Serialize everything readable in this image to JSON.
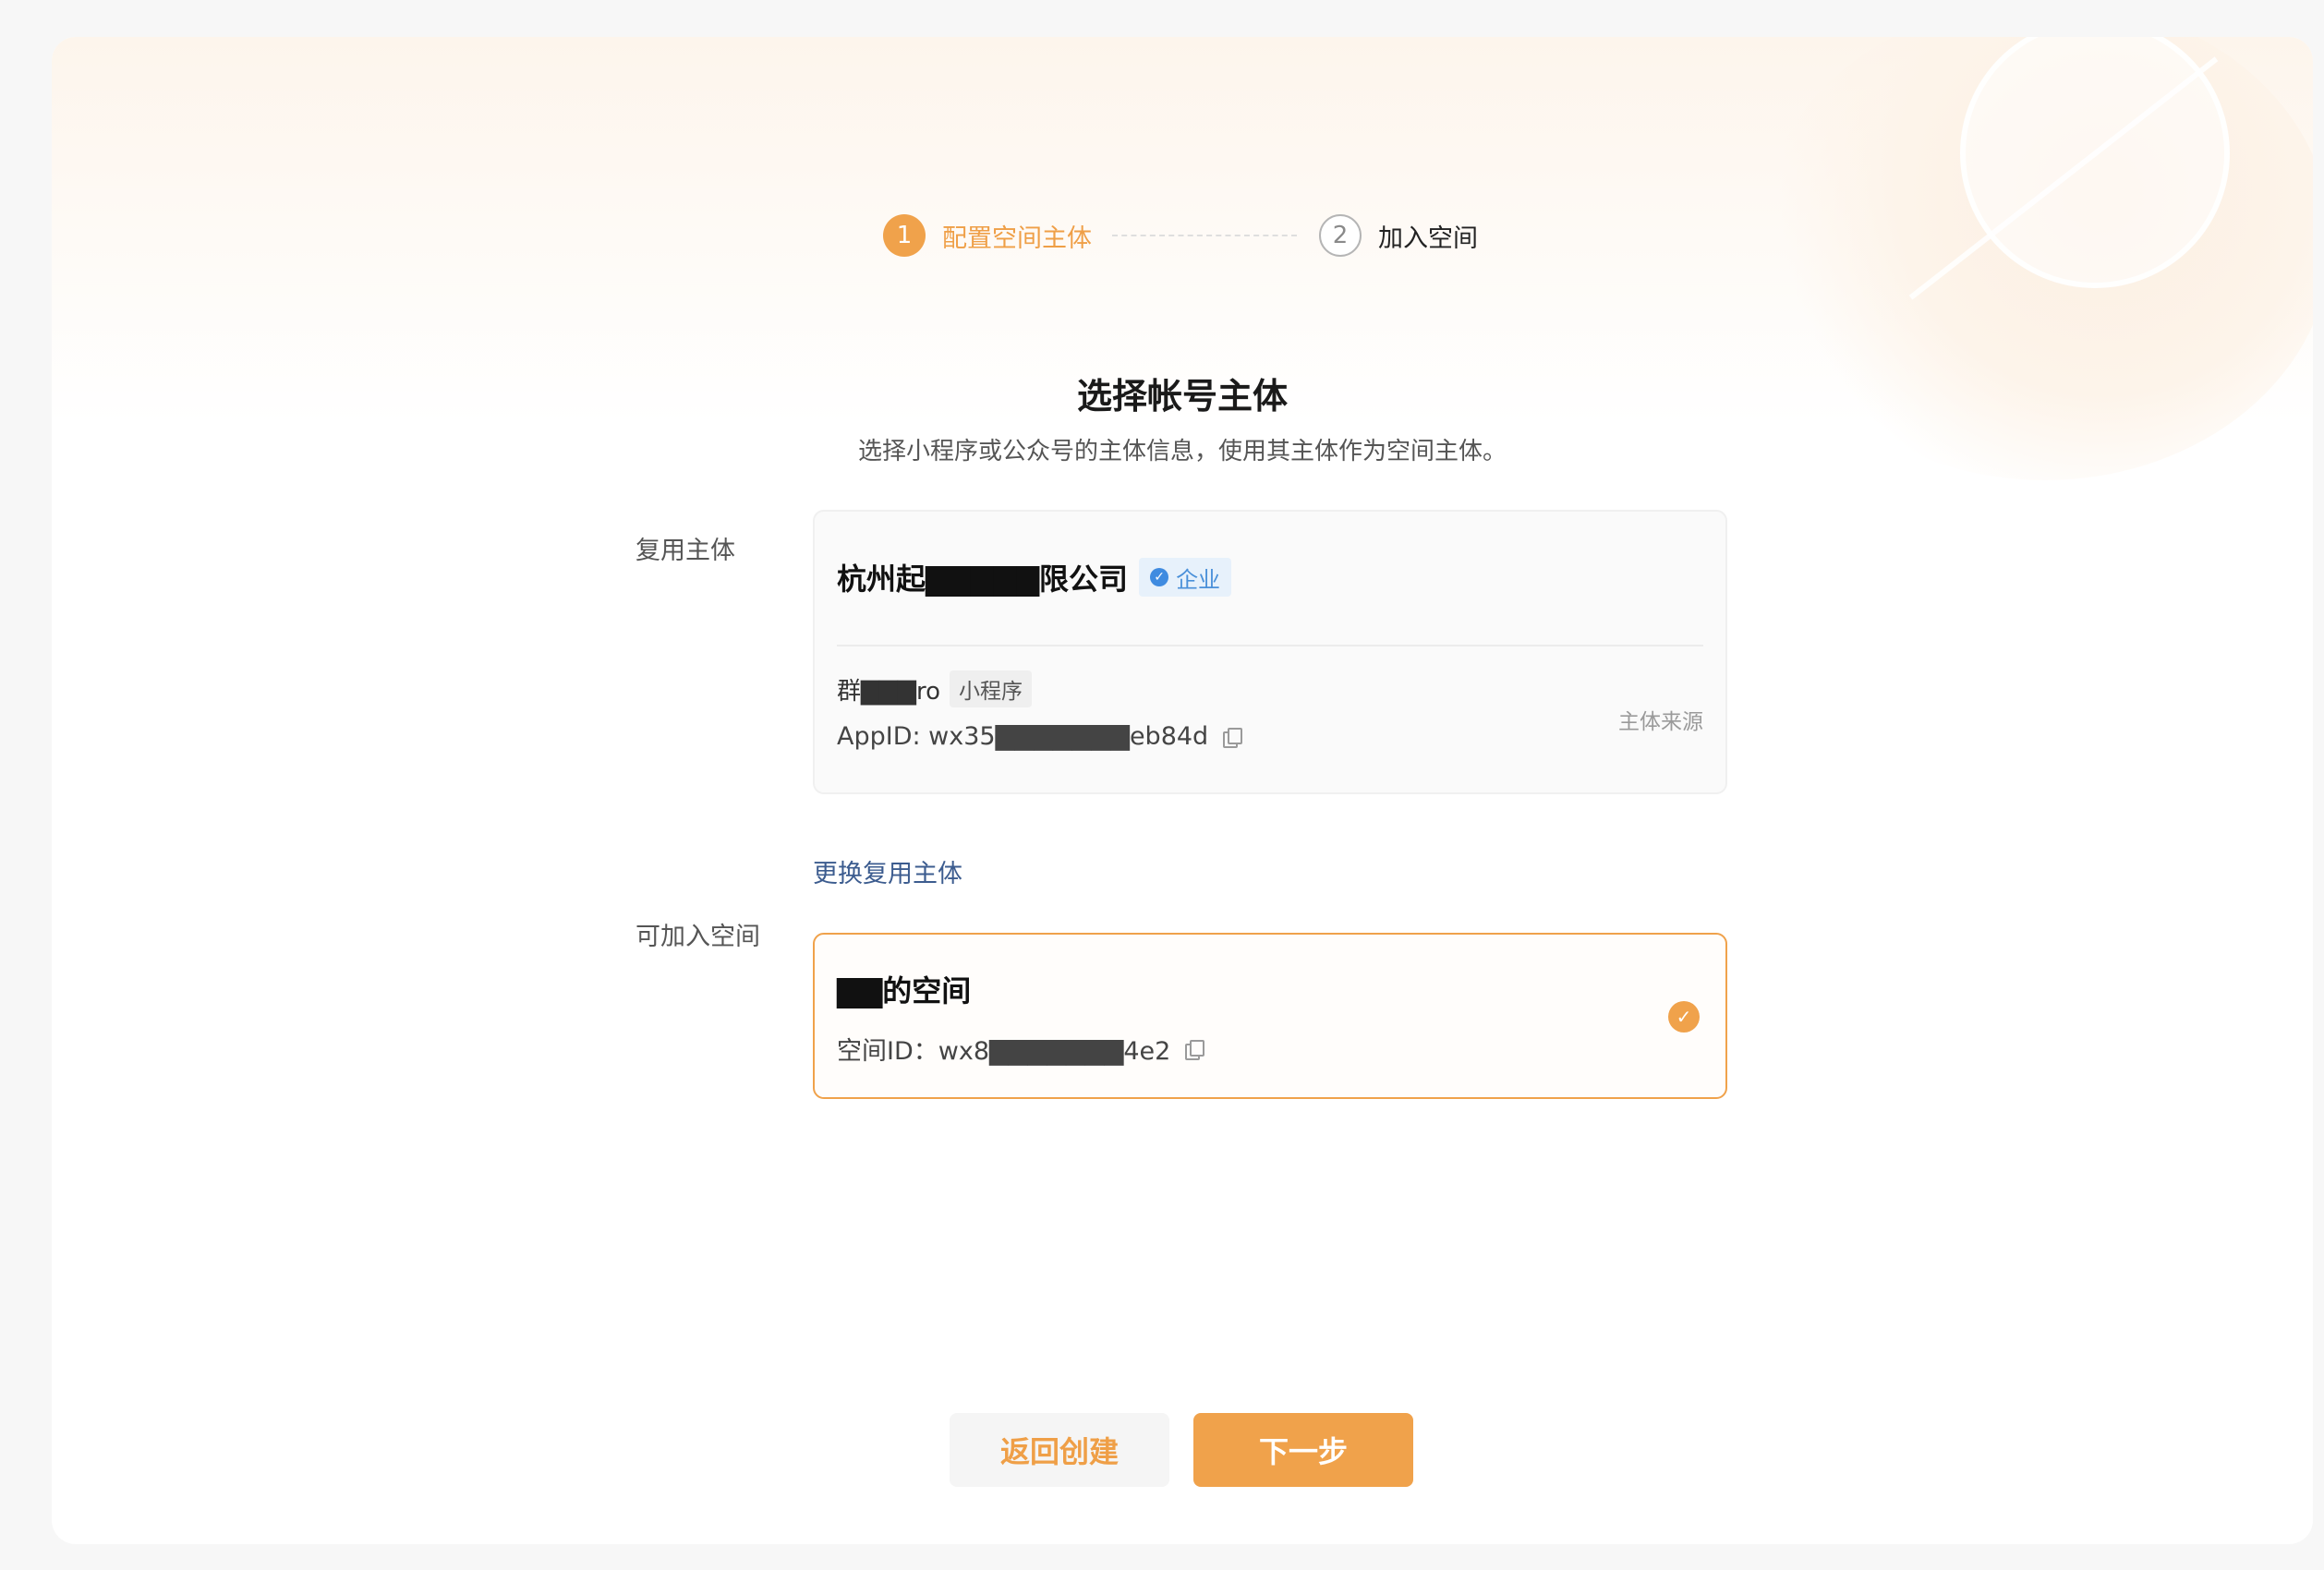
{
  "stepper": {
    "steps": [
      {
        "number": "1",
        "label": "配置空间主体"
      },
      {
        "number": "2",
        "label": "加入空间"
      }
    ]
  },
  "header": {
    "title": "选择帐号主体",
    "subtitle": "选择小程序或公众号的主体信息，使用其主体作为空间主体。"
  },
  "reuse_entity": {
    "label": "复用主体",
    "company_name": "杭州起▇▇▇▇▇限公司",
    "company_type": "企业",
    "app_name": "群▇▇▇ro",
    "app_type": "小程序",
    "app_id": "AppID: wx35▇▇▇▇▇▇▇eb84d",
    "source_label": "主体来源",
    "change_link": "更换复用主体"
  },
  "joinable_space": {
    "label": "可加入空间",
    "space_name": "▇▇的空间",
    "space_id": "空间ID：wx8▇▇▇▇▇▇▇4e2"
  },
  "actions": {
    "back_label": "返回创建",
    "next_label": "下一步"
  },
  "colors": {
    "accent": "#f0a24b",
    "link": "#3c5c8f",
    "badge_blue": "#4a90d9"
  }
}
